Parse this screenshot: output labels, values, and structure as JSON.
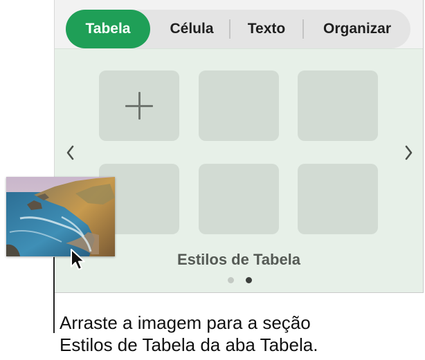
{
  "tabs": [
    {
      "label": "Tabela",
      "active": true
    },
    {
      "label": "Célula",
      "active": false
    },
    {
      "label": "Texto",
      "active": false
    },
    {
      "label": "Organizar",
      "active": false
    }
  ],
  "table_styles": {
    "section_label": "Estilos de Tabela",
    "tiles": [
      "add-style",
      "style",
      "style",
      "style",
      "style",
      "style"
    ],
    "page_dots": {
      "count": 2,
      "current": 2
    }
  },
  "icons": {
    "prev": "chevron-left-icon",
    "next": "chevron-right-icon",
    "add": "plus-icon",
    "pointer": "arrow-cursor-icon"
  },
  "colors": {
    "accent": "#1f9f57",
    "panel_bg": "#e7f0e8",
    "tile_bg": "#d2dbd3"
  },
  "callout": {
    "line1": "Arraste a imagem para a seção",
    "line2": "Estilos de Tabela da aba Tabela."
  },
  "dragged_image": {
    "subject": "coastal-landscape-photo"
  }
}
